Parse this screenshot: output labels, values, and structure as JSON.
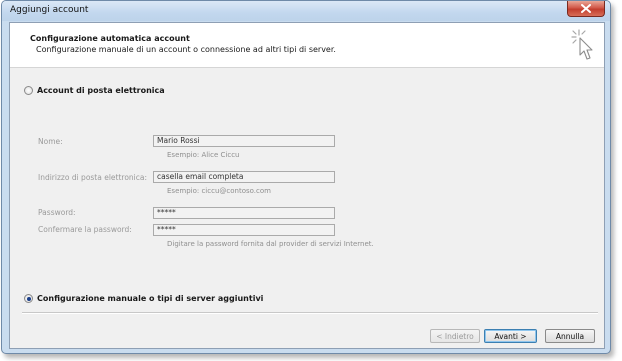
{
  "window": {
    "title": "Aggiungi account"
  },
  "header": {
    "title": "Configurazione automatica account",
    "subtitle": "Configurazione manuale di un account o connessione ad altri tipi di server."
  },
  "options": {
    "email_account_label": "Account di posta elettronica",
    "manual_config_label": "Configurazione manuale o tipi di server aggiuntivi",
    "selected": "manual"
  },
  "form": {
    "name_label": "Nome:",
    "name_value": "Mario Rossi",
    "name_hint": "Esempio: Alice Ciccu",
    "email_label": "Indirizzo di posta elettronica:",
    "email_value": "casella email completa",
    "email_hint": "Esempio: ciccu@contoso.com",
    "password_label": "Password:",
    "password_value": "*****",
    "confirm_label": "Confermare la password:",
    "confirm_value": "*****",
    "password_hint": "Digitare la password fornita dal provider di servizi Internet."
  },
  "buttons": {
    "back": "< Indietro",
    "next": "Avanti >",
    "cancel": "Annulla"
  }
}
